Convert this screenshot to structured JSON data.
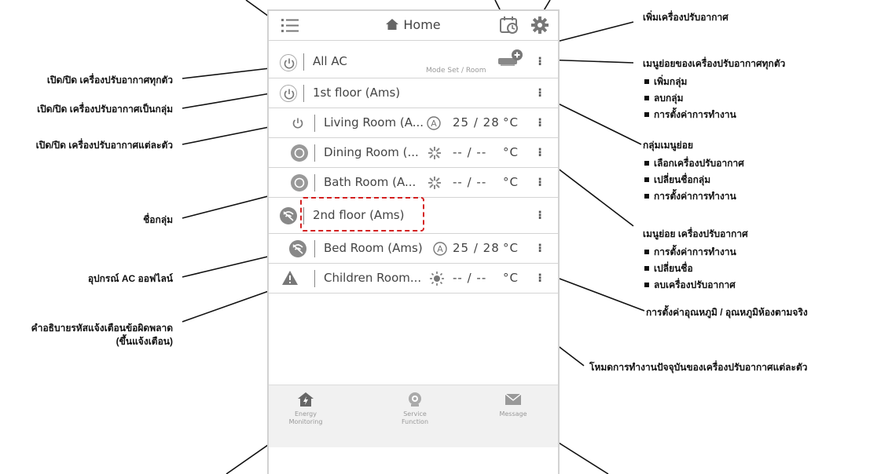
{
  "header": {
    "title": "Home"
  },
  "all_ac": {
    "label": "All AC",
    "sub_label": "Mode  Set / Room"
  },
  "groups": [
    {
      "name": "1st floor (Ams)",
      "units": [
        {
          "name": "Living Room (A...",
          "mode": "A",
          "temp": "25 / 28",
          "unit": "°C",
          "status": "on"
        },
        {
          "name": "Dining Room (...",
          "mode": "fan",
          "temp": "-- / --",
          "unit": "°C",
          "status": "off"
        },
        {
          "name": "Bath Room (A...",
          "mode": "fan",
          "temp": "-- / --",
          "unit": "°C",
          "status": "off"
        }
      ]
    },
    {
      "name": "2nd floor (Ams)",
      "units": [
        {
          "name": "Bed Room (Ams)",
          "mode": "A",
          "temp": "25 / 28",
          "unit": "°C",
          "status": "offline"
        },
        {
          "name": "Children Room...",
          "mode": "sun",
          "temp": "-- / --",
          "unit": "°C",
          "status": "error"
        }
      ]
    }
  ],
  "bottom_nav": [
    {
      "label_1": "Energy",
      "label_2": "Monitoring",
      "icon": "house-energy-icon"
    },
    {
      "label_1": "Service",
      "label_2": "Function",
      "icon": "service-icon"
    },
    {
      "label_1": "Message",
      "label_2": "",
      "icon": "envelope-icon"
    }
  ],
  "annotations": {
    "add_ac": "เพิ่มเครื่องปรับอากาศ",
    "all_ac_menu": {
      "title": "เมนูย่อยของเครื่องปรับอากาศทุกตัว",
      "items": [
        "เพิ่มกลุ่ม",
        "ลบกลุ่ม",
        "การตั้งค่าการทำงาน"
      ]
    },
    "group_menu": {
      "title": "กลุ่มเมนูย่อย",
      "items": [
        "เลือกเครื่องปรับอากาศ",
        "เปลี่ยนชื่อกลุ่ม",
        "การตั้งค่าการทำงาน"
      ]
    },
    "ac_menu": {
      "title": "เมนูย่อย เครื่องปรับอากาศ",
      "items": [
        "การตั้งค่าการทำงาน",
        "เปลี่ยนชื่อ",
        "ลบเครื่องปรับอากาศ"
      ]
    },
    "temp_setting": "การตั้งค่าอุณหภูมิ / อุณหภูมิห้องตามจริง",
    "current_mode": "โหมดการทำงานปัจจุบันของเครื่องปรับอากาศแต่ละตัว",
    "power_all": "เปิด/ปิด  เครื่องปรับอากาศทุกตัว",
    "power_group": "เปิด/ปิด  เครื่องปรับอากาศเป็นกลุ่ม",
    "power_each": "เปิด/ปิด  เครื่องปรับอากาศแต่ละตัว",
    "group_name": "ชื่อกลุ่ม",
    "offline": "อุปกรณ์ AC ออฟไลน์",
    "error_1": "คำอธิบายรหัสแจ้งเตือนข้อผิดพลาด",
    "error_2": "(ขึ้นแจ้งเตือน)"
  }
}
